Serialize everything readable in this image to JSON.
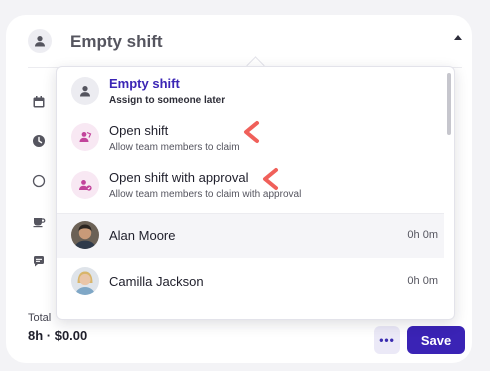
{
  "header": {
    "title": "Empty shift"
  },
  "dropdown": {
    "options": [
      {
        "title": "Empty shift",
        "subtitle": "Assign to someone later",
        "icon": "person-icon"
      },
      {
        "title": "Open shift",
        "subtitle": "Allow team members to claim",
        "icon": "open-shift-icon"
      },
      {
        "title": "Open shift with approval",
        "subtitle": "Allow team members to claim with approval",
        "icon": "open-shift-approval-icon"
      }
    ],
    "people": [
      {
        "name": "Alan Moore",
        "hours": "0h 0m"
      },
      {
        "name": "Camilla Jackson",
        "hours": "0h 0m"
      }
    ]
  },
  "footer": {
    "total_label": "Total",
    "total_value": "8h · $0.00",
    "more_label": "•••",
    "save_label": "Save"
  },
  "colors": {
    "accent": "#3a23b5",
    "annotation": "#f0605a",
    "open_shift_icon": "#c2449b"
  }
}
